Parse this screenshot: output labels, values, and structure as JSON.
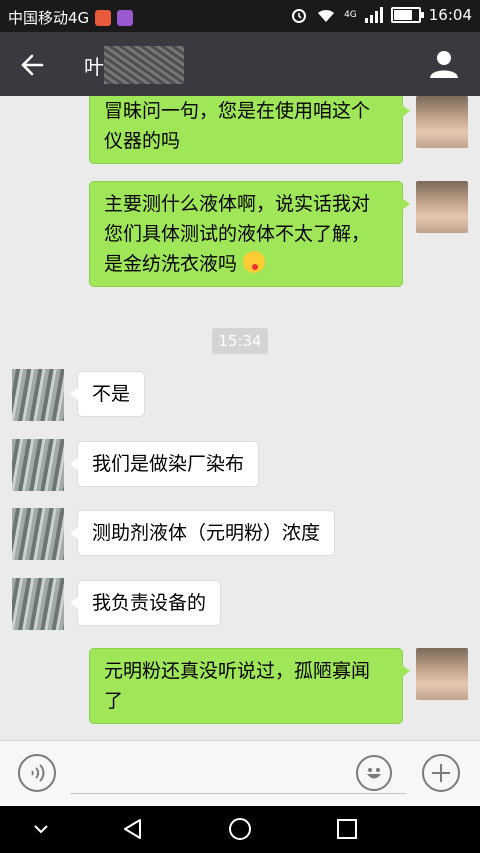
{
  "status": {
    "carrier": "中国移动4G",
    "network": "4G",
    "time": "16:04"
  },
  "header": {
    "title": "叶"
  },
  "messages": [
    {
      "side": "me",
      "text": "冒昧问一句，您是在使用咱这个仪器的吗"
    },
    {
      "side": "me",
      "text": "主要测什么液体啊，说实话我对您们具体测试的液体不太了解，是金纺洗衣液吗"
    },
    {
      "side": "time",
      "text": "15:34"
    },
    {
      "side": "them",
      "text": "不是"
    },
    {
      "side": "them",
      "text": "我们是做染厂染布"
    },
    {
      "side": "them",
      "text": "测助剂液体（元明粉）浓度"
    },
    {
      "side": "them",
      "text": "我负责设备的"
    },
    {
      "side": "me",
      "text": "元明粉还真没听说过，孤陋寡闻了"
    }
  ],
  "icons": {
    "back": "arrow-left-icon",
    "profile": "user-icon",
    "voice": "voice-icon",
    "emoji": "emoji-icon",
    "add": "plus-icon"
  },
  "colors": {
    "my_bubble": "#9fe658",
    "their_bubble": "#ffffff",
    "titlebar": "#393a3f"
  }
}
